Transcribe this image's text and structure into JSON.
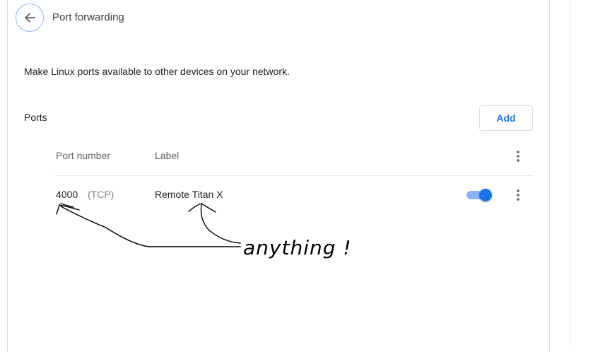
{
  "header": {
    "title": "Port forwarding",
    "back_icon": "arrow-left-icon"
  },
  "description": "Make Linux ports available to other devices on your network.",
  "ports": {
    "section_label": "Ports",
    "add_label": "Add",
    "columns": {
      "port_number": "Port number",
      "label": "Label"
    },
    "rows": [
      {
        "port": "4000",
        "protocol": "(TCP)",
        "label": "Remote Titan X",
        "enabled": true
      }
    ]
  },
  "annotation": {
    "text": "anything !"
  },
  "colors": {
    "accent": "#1a73e8",
    "toggle_track": "#8ab4f8",
    "divider": "#e8eaed"
  }
}
